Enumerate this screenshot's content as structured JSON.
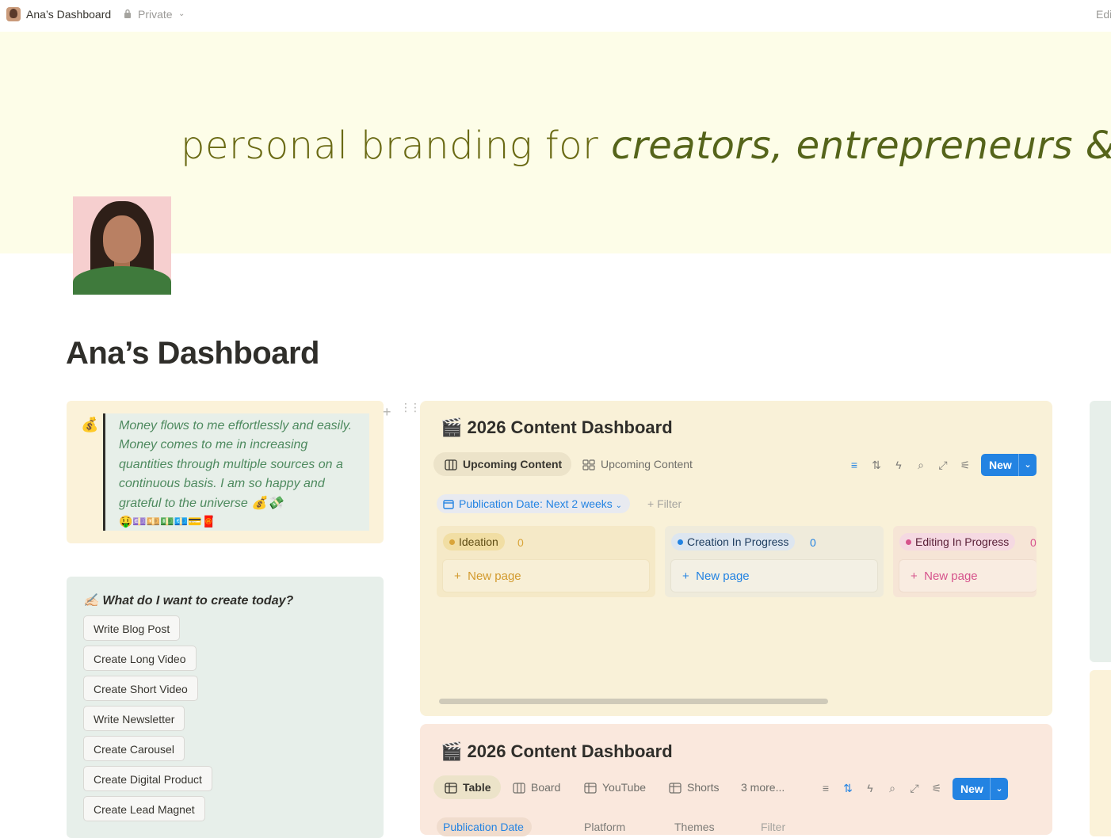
{
  "topbar": {
    "page_title": "Ana’s Dashboard",
    "privacy": "Private",
    "edit_label": "Edi"
  },
  "cover": {
    "text_plain": "personal branding for ",
    "text_italic": "creators, entrepreneurs & bloggers"
  },
  "page": {
    "title": "Ana’s Dashboard"
  },
  "affirmation": {
    "emoji": "💰",
    "text": "Money flows to me effortlessly and easily. Money comes to me in increasing quantities through multiple sources on a continuous basis. I am so happy and grateful to the universe 💰💸",
    "tail_emojis": "🤑💷💴💵💶💳🧧"
  },
  "create_panel": {
    "heading": "✍🏻 What do I want to create today?",
    "buttons": [
      "Write Blog Post",
      "Create Long Video",
      "Create Short Video",
      "Write Newsletter",
      "Create Carousel",
      "Create Digital Product",
      "Create Lead Magnet"
    ]
  },
  "dashboard1": {
    "title": "🎬 2026 Content Dashboard",
    "tabs": [
      "Upcoming Content",
      "Upcoming Content"
    ],
    "new_label": "New",
    "filter_chip": "Publication Date: Next 2 weeks",
    "filter_label": "Filter",
    "columns": [
      {
        "name": "Ideation",
        "count": "0",
        "new_page": "New page"
      },
      {
        "name": "Creation In Progress",
        "count": "0",
        "new_page": "New page"
      },
      {
        "name": "Editing In Progress",
        "count": "0",
        "new_page": "New page"
      }
    ]
  },
  "dashboard2": {
    "title": "🎬 2026 Content Dashboard",
    "tabs": [
      "Table",
      "Board",
      "YouTube",
      "Shorts"
    ],
    "more_label": "3 more...",
    "new_label": "New",
    "filters": [
      "Publication Date",
      "Platform",
      "Themes",
      "Filter"
    ]
  },
  "colors": {
    "accent_blue": "#2383e2",
    "cover_text": "#6a6a14",
    "quote_text": "#4e8a5f",
    "ideation": "#d9a53a",
    "creation": "#2383e2",
    "editing": "#d6538c"
  }
}
